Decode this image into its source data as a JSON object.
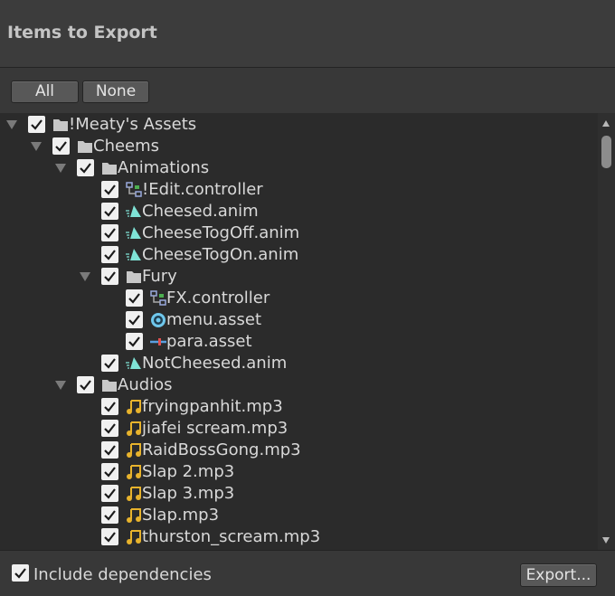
{
  "header": {
    "title": "Items to Export"
  },
  "buttons": {
    "all": "All",
    "none": "None"
  },
  "tree": [
    {
      "label": "!Meaty's Assets",
      "depth": 0,
      "type": "folder",
      "expanded": true,
      "checked": true
    },
    {
      "label": "Cheems",
      "depth": 1,
      "type": "folder",
      "expanded": true,
      "checked": true
    },
    {
      "label": "Animations",
      "depth": 2,
      "type": "folder",
      "expanded": true,
      "checked": true
    },
    {
      "label": "!Edit.controller",
      "depth": 3,
      "type": "controller",
      "checked": true
    },
    {
      "label": "Cheesed.anim",
      "depth": 3,
      "type": "anim",
      "checked": true
    },
    {
      "label": "CheeseTogOff.anim",
      "depth": 3,
      "type": "anim",
      "checked": true
    },
    {
      "label": "CheeseTogOn.anim",
      "depth": 3,
      "type": "anim",
      "checked": true
    },
    {
      "label": "Fury",
      "depth": 3,
      "type": "folder",
      "expanded": true,
      "checked": true
    },
    {
      "label": "FX.controller",
      "depth": 4,
      "type": "controller",
      "checked": true
    },
    {
      "label": "menu.asset",
      "depth": 4,
      "type": "menu",
      "checked": true
    },
    {
      "label": "para.asset",
      "depth": 4,
      "type": "param",
      "checked": true
    },
    {
      "label": "NotCheesed.anim",
      "depth": 3,
      "type": "anim",
      "checked": true
    },
    {
      "label": "Audios",
      "depth": 2,
      "type": "folder",
      "expanded": true,
      "checked": true
    },
    {
      "label": "fryingpanhit.mp3",
      "depth": 3,
      "type": "audio",
      "checked": true
    },
    {
      "label": "jiafei scream.mp3",
      "depth": 3,
      "type": "audio",
      "checked": true
    },
    {
      "label": "RaidBossGong.mp3",
      "depth": 3,
      "type": "audio",
      "checked": true
    },
    {
      "label": "Slap 2.mp3",
      "depth": 3,
      "type": "audio",
      "checked": true
    },
    {
      "label": "Slap 3.mp3",
      "depth": 3,
      "type": "audio",
      "checked": true
    },
    {
      "label": "Slap.mp3",
      "depth": 3,
      "type": "audio",
      "checked": true
    },
    {
      "label": "thurston_scream.mp3",
      "depth": 3,
      "type": "audio",
      "checked": true
    }
  ],
  "footer": {
    "include_dependencies": "Include dependencies",
    "include_checked": true,
    "export_label": "Export..."
  },
  "colors": {
    "anim": "#7fe3d6",
    "audio": "#e8b32c",
    "folder": "#c8c8c8",
    "menu": "#6fc7ec"
  }
}
